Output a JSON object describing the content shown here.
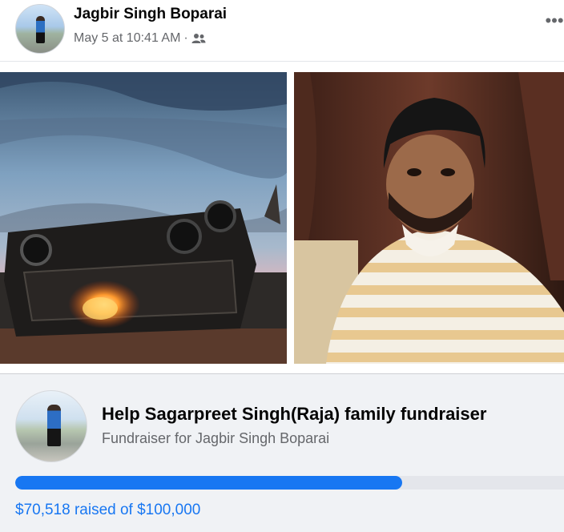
{
  "post": {
    "author": "Jagbir Singh Boparai",
    "timestamp": "May 5 at 10:41 AM",
    "separator": "·",
    "audience_icon": "group-icon",
    "more_label": "•••"
  },
  "photos": [
    {
      "subject": "overturned burning truck at dusk"
    },
    {
      "subject": "young man in striped shirt"
    }
  ],
  "fundraiser": {
    "title": "Help Sagarpreet Singh(Raja) family fundraiser",
    "subtitle": "Fundraiser for Jagbir Singh Boparai",
    "raised_text": "$70,518 raised of $100,000",
    "raised": 70518,
    "goal": 100000
  },
  "colors": {
    "accent": "#1877f2",
    "card_bg": "#f0f2f5",
    "muted_text": "#65676b"
  }
}
